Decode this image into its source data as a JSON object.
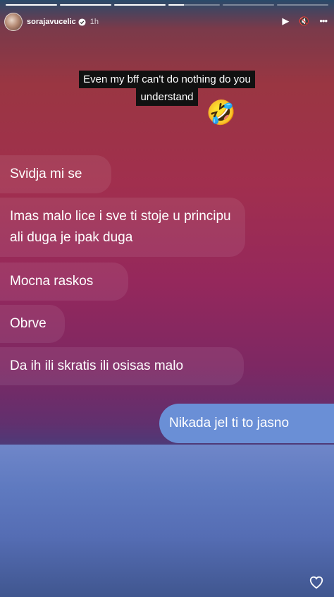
{
  "story": {
    "username": "sorajavucelic",
    "time": "1h",
    "progress": [
      1,
      1,
      1,
      0.3,
      0,
      0
    ],
    "caption_lines": [
      "Even my bff can't do nothing do you",
      "understand"
    ],
    "emoji": "🤣",
    "controls": {
      "play": "▶",
      "mute": "🔇",
      "more": "•••"
    }
  },
  "messages": [
    {
      "text": "Svidja mi se"
    },
    {
      "text": "Imas malo lice i sve ti stoje u principu ali duga je ipak duga"
    },
    {
      "text": "Mocna raskos"
    },
    {
      "text": "Obrve"
    },
    {
      "text": "Da ih ili skratis ili osisas malo"
    },
    {
      "text": "Nikada jel ti to jasno"
    }
  ]
}
